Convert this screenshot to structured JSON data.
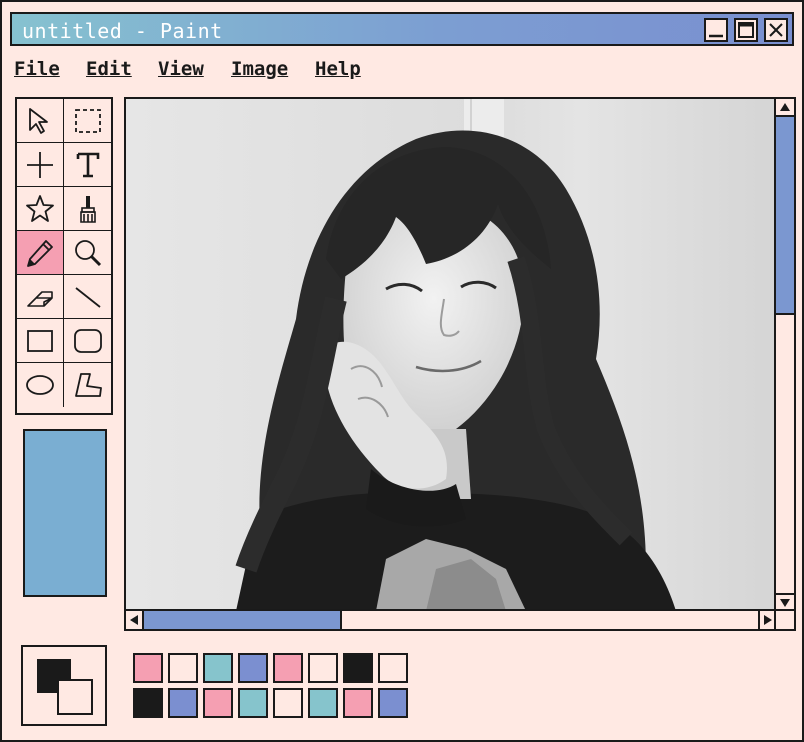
{
  "window": {
    "title": "untitled - Paint"
  },
  "menu": [
    "File",
    "Edit",
    "View",
    "Image",
    "Help"
  ],
  "tools": [
    "select-arrow",
    "select-rect",
    "crosshair",
    "text",
    "star",
    "brush",
    "pencil",
    "magnifier",
    "eraser",
    "line",
    "rectangle",
    "rounded-rectangle",
    "ellipse",
    "polygon"
  ],
  "selected_tool": "pencil",
  "colors": {
    "background": "#ffe9e3",
    "title_gradient": [
      "#86c2d0",
      "#7a8fd0"
    ],
    "current_color": "#7aaed2",
    "scroll_thumb": "#7b97d0"
  },
  "scroll": {
    "vertical_position": 0.0,
    "horizontal_position": 0.0
  },
  "palette": {
    "row1": [
      "#f59fb2",
      "#ffe9e3",
      "#86c4cc",
      "#7b8fd0",
      "#f59fb2",
      "#ffe9e3",
      "#1a1a1a",
      "#ffe9e3"
    ],
    "row2": [
      "#1a1a1a",
      "#7b8fd0",
      "#f59fb2",
      "#86c4cc",
      "#ffe9e3",
      "#86c4cc",
      "#f59fb2",
      "#7b8fd0"
    ]
  }
}
